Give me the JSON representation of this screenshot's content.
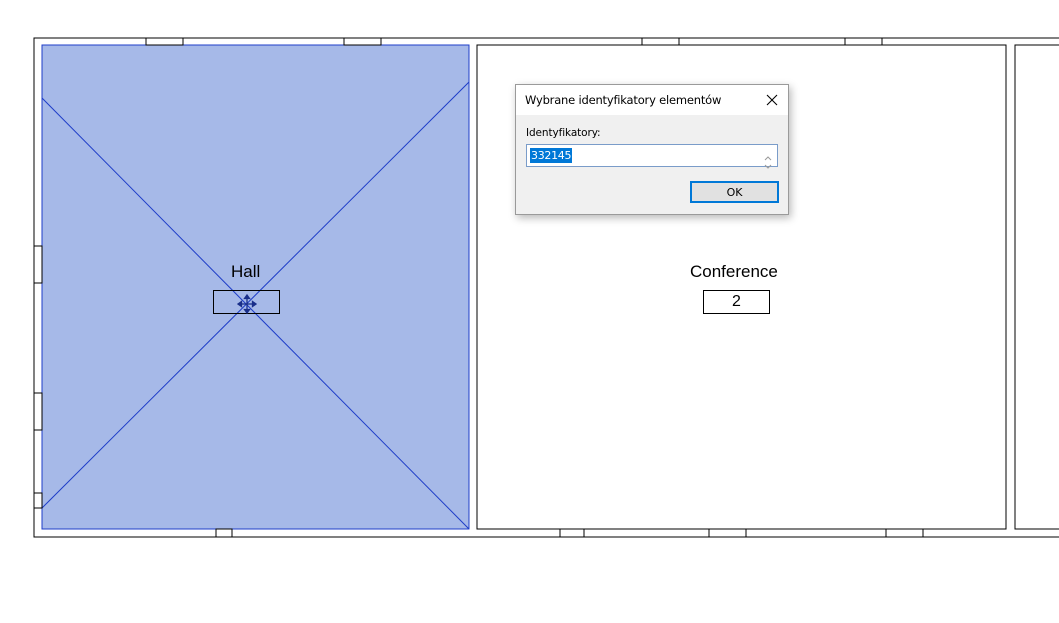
{
  "rooms": [
    {
      "name": "Hall",
      "number": ""
    },
    {
      "name": "Conference",
      "number": "2"
    }
  ],
  "dialog": {
    "title": "Wybrane identyfikatory elementów",
    "field_label": "Identyfikatory:",
    "id_value": "332145",
    "ok_label": "OK"
  },
  "icons": {
    "close": "close-icon",
    "move": "move-cursor-icon",
    "spinner_up": "chevron-up-icon",
    "spinner_down": "chevron-down-icon"
  },
  "colors": {
    "selection_fill": "#a6b9e8",
    "selection_stroke": "#1e3dc8",
    "wall": "#000000",
    "highlight": "#0078d7"
  }
}
